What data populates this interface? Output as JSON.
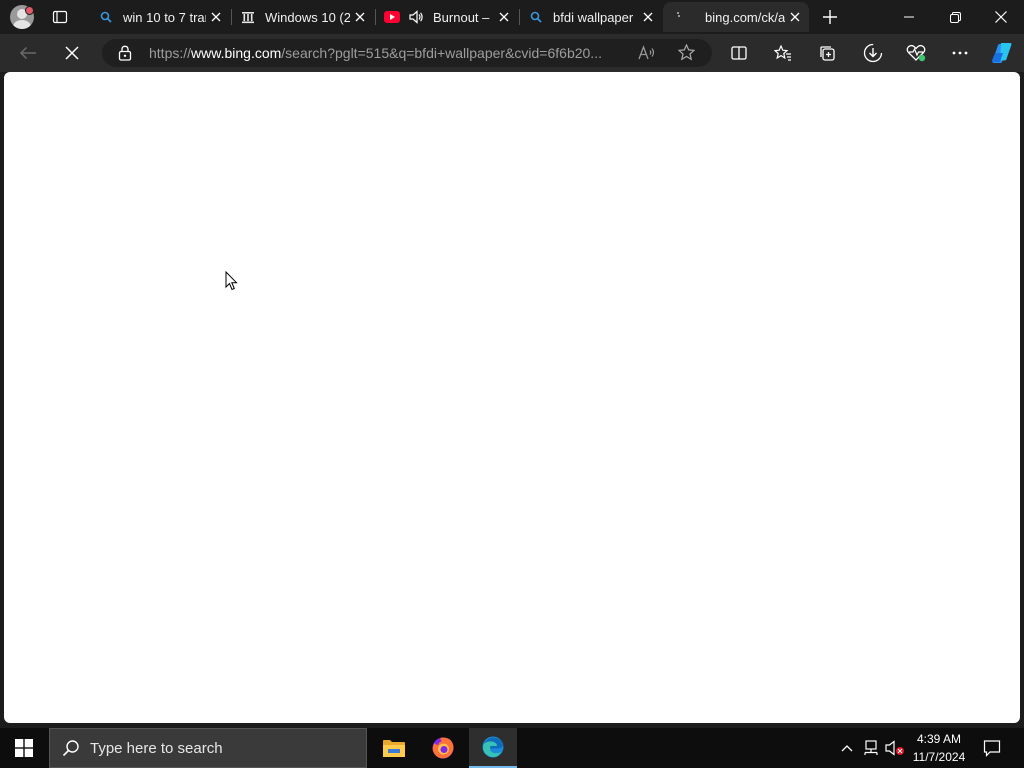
{
  "tabs": [
    {
      "title": "win 10 to 7 trar",
      "icon": "bing-search-icon",
      "active": false
    },
    {
      "title": "Windows 10 (2)",
      "icon": "archive-icon",
      "active": false
    },
    {
      "title": "Burnout –",
      "icon": "youtube-icon",
      "audio": true,
      "active": false
    },
    {
      "title": "bfdi wallpaper",
      "icon": "bing-search-icon",
      "active": false
    },
    {
      "title": "bing.com/ck/a?",
      "icon": "loading-icon",
      "active": true
    }
  ],
  "address": {
    "prefix": "https://",
    "host": "www.bing.com",
    "path": "/search?pglt=515&q=bfdi+wallpaper&cvid=6f6b20..."
  },
  "taskbar": {
    "search_placeholder": "Type here to search",
    "time": "4:39 AM",
    "date": "11/7/2024",
    "apps": [
      "file-explorer-icon",
      "firefox-icon",
      "edge-icon"
    ]
  },
  "colors": {
    "accent": "#0078d4",
    "chrome": "#1c1c1c",
    "toolbar": "#2b2b2b",
    "page": "#ffffff",
    "taskbar": "#0d0d0d"
  }
}
